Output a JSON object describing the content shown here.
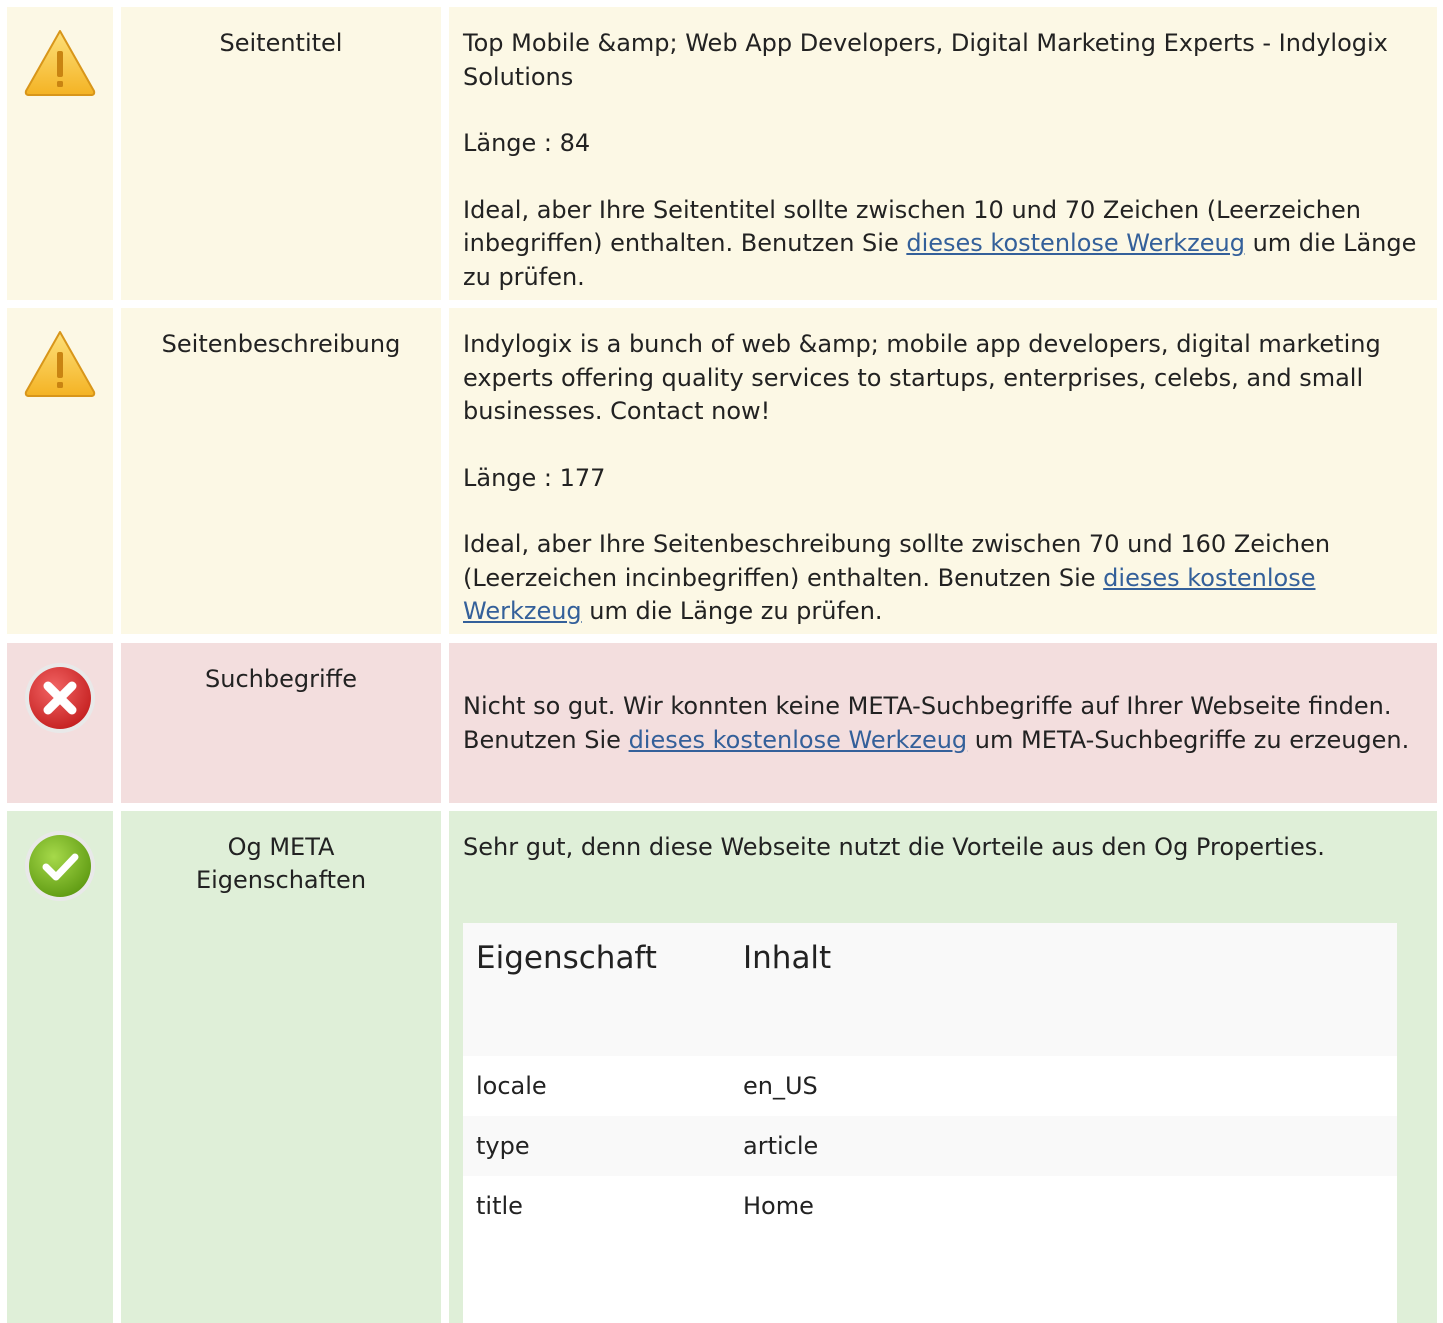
{
  "rows": {
    "title": {
      "status": "warning",
      "label": "Seitentitel",
      "value": "Top Mobile &amp; Web App Developers, Digital Marketing Experts - Indylogix Solutions",
      "length": "Länge : 84",
      "advice_pre": "Ideal, aber Ihre Seitentitel sollte zwischen 10 und 70 Zeichen (Leerzeichen inbegriffen) enthalten. Benutzen Sie ",
      "link": "dieses kostenlose Werkzeug",
      "advice_post": " um die Länge zu prüfen."
    },
    "description": {
      "status": "warning",
      "label": "Seitenbeschreibung",
      "value": "Indylogix is a bunch of web &amp; mobile app developers, digital marketing experts offering quality services to startups, enterprises, celebs, and small businesses. Contact now!",
      "length": "Länge : 177",
      "advice_pre": "Ideal, aber Ihre Seitenbeschreibung sollte zwischen 70 und 160 Zeichen (Leerzeichen incinbegriffen) enthalten. Benutzen Sie ",
      "link": "dieses kostenlose Werkzeug",
      "advice_post": " um die Länge zu prüfen."
    },
    "keywords": {
      "status": "error",
      "label": "Suchbegriffe",
      "advice_pre": "Nicht so gut. Wir konnten keine META-Suchbegriffe auf Ihrer Webseite finden. Benutzen Sie ",
      "link": "dieses kostenlose Werkzeug",
      "advice_post": " um META-Suchbegriffe zu erzeugen."
    },
    "og": {
      "status": "ok",
      "label": "Og META Eigenschaften",
      "text": "Sehr gut, denn diese Webseite nutzt die Vorteile aus den Og Properties.",
      "table": {
        "headers": [
          "Eigenschaft",
          "Inhalt"
        ],
        "rows": [
          [
            "locale",
            "en_US"
          ],
          [
            "type",
            "article"
          ],
          [
            "title",
            "Home"
          ]
        ]
      }
    }
  },
  "colors": {
    "warning_bg": "#fcf8e5",
    "error_bg": "#f3dede",
    "ok_bg": "#dfefd8",
    "link": "#34609a"
  },
  "icons": {
    "warning": "warning-triangle-icon",
    "error": "error-x-icon",
    "ok": "check-circle-icon"
  }
}
